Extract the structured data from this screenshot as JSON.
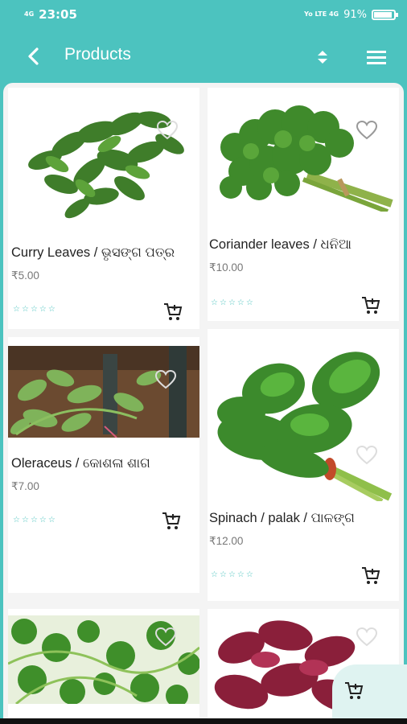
{
  "status_bar": {
    "network_left": "4G",
    "time": "23:05",
    "network_right": "Yo LTE 4G",
    "battery": "91%"
  },
  "app_bar": {
    "title": "Products",
    "back_icon": "back-arrow-icon",
    "sort_icon": "sort-icon",
    "menu_icon": "menu-icon"
  },
  "colors": {
    "primary": "#4cc3bf",
    "rating": "#4cc3bf"
  },
  "products": [
    {
      "name": "Curry Leaves / ଭୃସଙ୍ଗ ପତ୍ର",
      "price": "₹5.00",
      "rating": 0
    },
    {
      "name": "Coriander leaves / ଧନିଆ",
      "price": "₹10.00",
      "rating": 0
    },
    {
      "name": "Oleraceus / କୋଶଳା ଶାଗ",
      "price": "₹7.00",
      "rating": 0
    },
    {
      "name": "Spinach / palak / ପାଳଙ୍ଗ",
      "price": "₹12.00",
      "rating": 0
    },
    {
      "name": "",
      "price": "",
      "rating": 0
    },
    {
      "name": "",
      "price": "",
      "rating": 0
    }
  ]
}
